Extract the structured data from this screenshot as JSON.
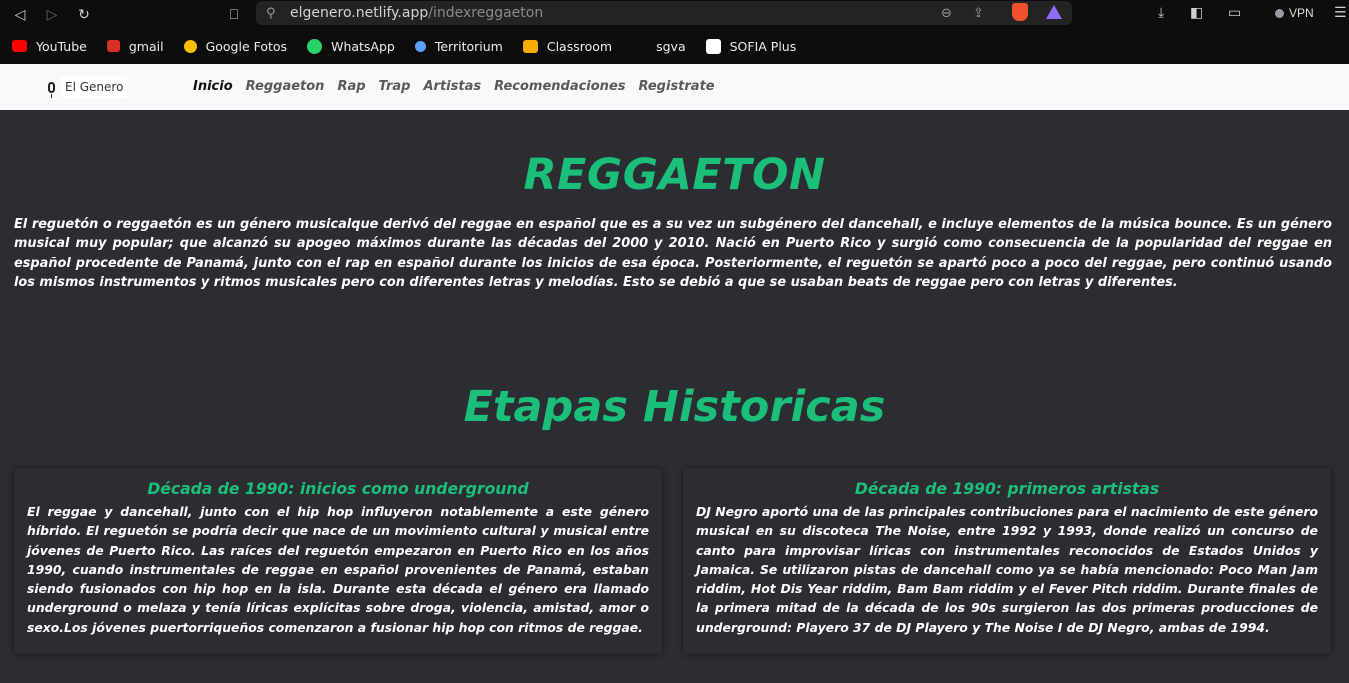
{
  "browser": {
    "url_host": "elgenero.netlify.app",
    "url_path": "/indexreggaeton",
    "vpn_label": "VPN"
  },
  "bookmarks": [
    {
      "label": "YouTube",
      "color": "#ff0000"
    },
    {
      "label": "gmail",
      "color": "#d93025"
    },
    {
      "label": "Google Fotos",
      "color": "#fbbc04"
    },
    {
      "label": "WhatsApp",
      "color": "#25d366"
    },
    {
      "label": "Territorium",
      "color": "#5aa0ff"
    },
    {
      "label": "Classroom",
      "color": "#f9ab00"
    },
    {
      "label": "sgva",
      "color": "#0d0d0d"
    },
    {
      "label": "SOFIA Plus",
      "color": "#ffffff"
    }
  ],
  "site": {
    "brand": "El Genero",
    "nav": [
      "Inicio",
      "Reggaeton",
      "Rap",
      "Trap",
      "Artistas",
      "Recomendaciones",
      "Registrate"
    ],
    "active_nav": "Inicio"
  },
  "main": {
    "title": "REGGAETON",
    "intro": "El reguetón o reggaetón es un género musicalque derivó del reggae en español que es a su vez un subgénero del dancehall, e incluye elementos de la música bounce. Es un género musical muy popular; que alcanzó su apogeo máximos durante las décadas del 2000 y 2010. Nació en Puerto Rico y surgió como consecuencia de la popularidad del reggae en español procedente de Panamá, junto con el rap en español durante los inicios de esa época. Posteriormente, el reguetón se apartó poco a poco del reggae, pero continuó usando los mismos instrumentos y ritmos musicales pero con diferentes letras y melodías. Esto se debió a que se usaban beats de reggae pero con letras y diferentes.",
    "section_title": "Etapas Historicas",
    "cards": [
      {
        "heading": "Década de 1990: inicios como underground",
        "text": "El reggae y dancehall, junto con el hip hop influyeron notablemente a este género híbrido. El reguetón se podría decir que nace de un movimiento cultural y musical entre jóvenes de Puerto Rico. Las raíces del reguetón empezaron en Puerto Rico en los años 1990, cuando instrumentales de reggae en español provenientes de Panamá, estaban siendo fusionados con hip hop en la isla. Durante esta década el género era llamado underground o melaza y tenía líricas explícitas sobre droga, violencia, amistad, amor o sexo.Los jóvenes puertorriqueños comenzaron a fusionar hip hop con ritmos de reggae."
      },
      {
        "heading": "Década de 1990: primeros artistas",
        "text": "DJ Negro aportó una de las principales contribuciones para el nacimiento de este género musical en su discoteca The Noise, entre 1992 y 1993, donde realizó un concurso de canto para improvisar líricas con instrumentales reconocidos de Estados Unidos y Jamaica. Se utilizaron pistas de dancehall como ya se había mencionado: Poco Man Jam riddim, Hot Dis Year riddim, Bam Bam riddim y el Fever Pitch riddim. Durante finales de la primera mitad de la década de los 90s surgieron las dos primeras producciones de underground: Playero 37 de DJ Playero y The Noise I de DJ Negro, ambas de 1994."
      }
    ]
  }
}
